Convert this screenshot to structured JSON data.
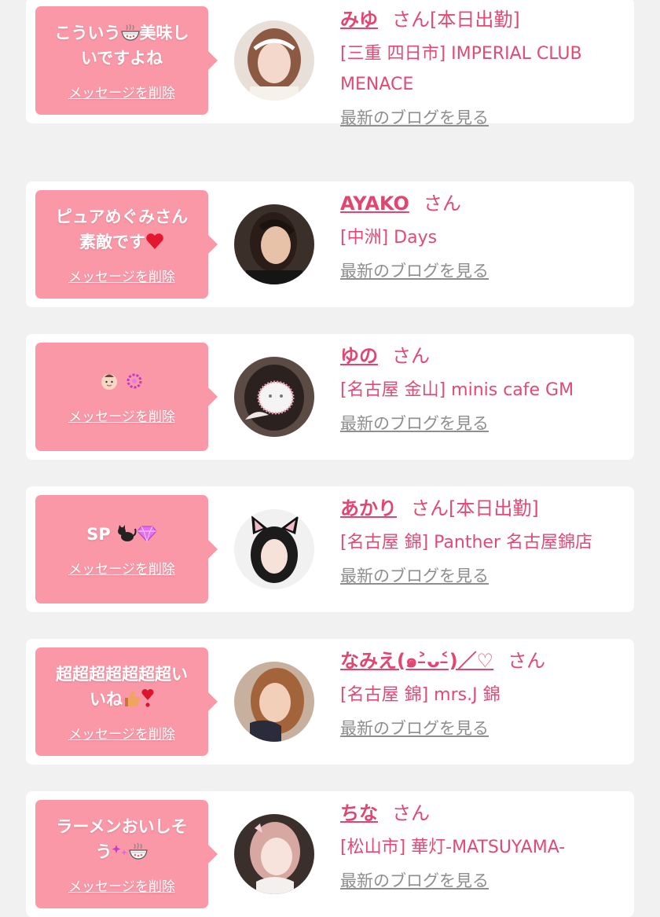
{
  "delete_label": "メッセージを削除",
  "blog_label": "最新のブログを見る",
  "honorific": "さん",
  "colors": {
    "bubble": "#fb98a8",
    "accent": "#e24a74",
    "link_gray": "#8e8e8e",
    "page_bg": "#f1f1f1"
  },
  "items": [
    {
      "message_parts": [
        "こういう",
        "ramen-bowl-icon",
        "美味し\nいですよね"
      ],
      "name": "みゆ",
      "status": "[本日出勤]",
      "shop": "[三重 四日市] IMPERIAL CLUB MENACE"
    },
    {
      "message_parts": [
        "ピュアめぐみさん\n素敵です",
        "heart-icon"
      ],
      "name": "AYAKO",
      "status": "",
      "shop": "[中洲] Days"
    },
    {
      "message_parts": [
        "baby-face-icon",
        " ",
        "sparkle-ring-icon"
      ],
      "name": "ゆの",
      "status": "",
      "shop": "[名古屋 金山] minis cafe GM"
    },
    {
      "message_parts": [
        "SP ",
        "black-cat-icon",
        "gem-icon"
      ],
      "name": "あかり",
      "status": "[本日出勤]",
      "shop": "[名古屋 錦] Panther 名古屋錦店"
    },
    {
      "message_parts": [
        "超超超超超超超い\nいね",
        "thumbs-up-icon",
        "exclamation-heart-icon"
      ],
      "name": "なみえ(๑˃̵ᴗ˂̵)／♡",
      "status": "",
      "shop": "[名古屋 錦] mrs.J 錦"
    },
    {
      "message_parts": [
        "ラーメンおいしそ\nう",
        "sparkles-icon",
        "ramen-bowl-icon"
      ],
      "name": "ちな",
      "status": "",
      "shop": "[松山市] 華灯-MATSUYAMA-"
    }
  ]
}
